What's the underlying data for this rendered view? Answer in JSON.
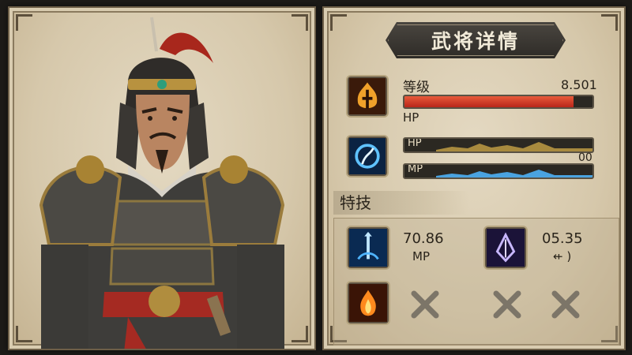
{
  "title": "武将详情",
  "stats": {
    "level_label": "等级",
    "level_value": "8.501",
    "level_fill": 0.9,
    "hp_label": "HP",
    "hp_bar_label": "HP",
    "mp_bar_label": "MP",
    "bar_value": "00"
  },
  "skills": {
    "section_title": "特技",
    "slot1_value": "70.86",
    "slot1_sub": "MP",
    "slot2_value": "05.35",
    "slot2_sub": "⇷ )"
  },
  "colors": {
    "accent_red": "#c8321f",
    "parchment": "#d6c8ab",
    "frame_dark": "#2e2b27"
  },
  "icons": {
    "level": "flame-crest-icon",
    "stats": "spirit-swirl-icon",
    "skill1": "blue-spear-icon",
    "skill2": "violet-crest-icon",
    "skill3": "flame-burst-icon",
    "empty": "crossed-x-icon"
  }
}
